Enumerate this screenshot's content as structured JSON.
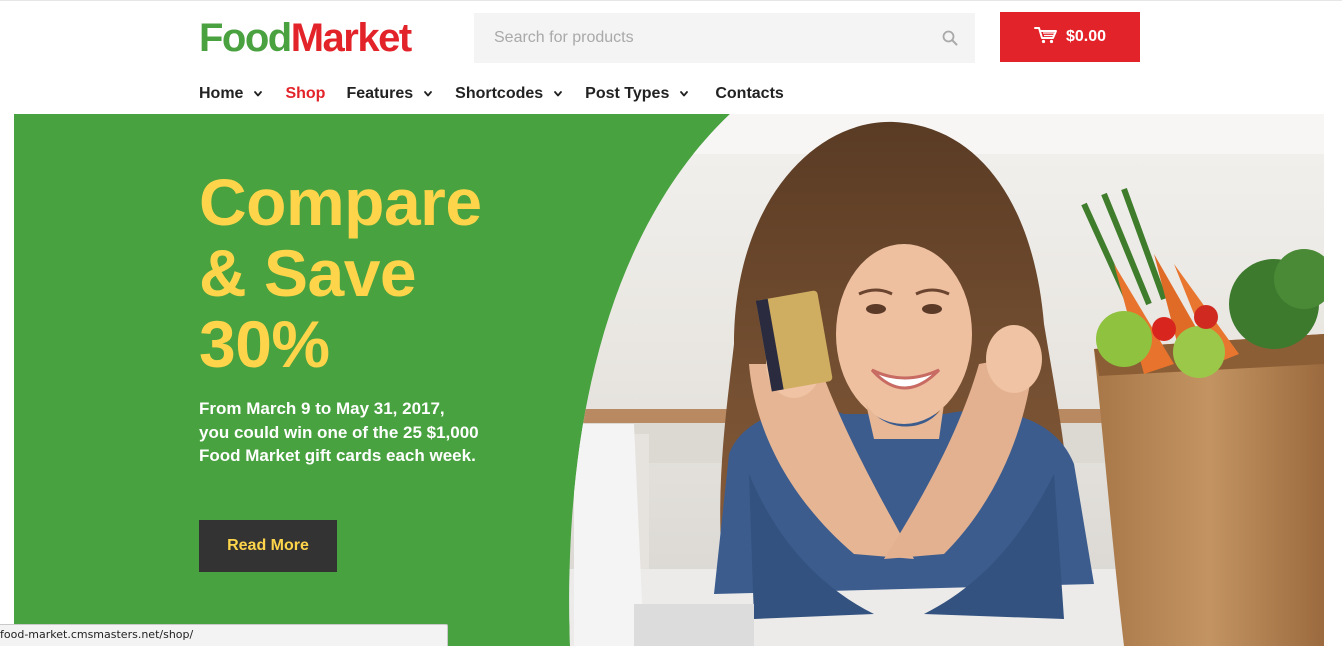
{
  "brand": {
    "logo_part1": "Food",
    "logo_part2": "Market",
    "primary_color": "#4aa13f",
    "accent_color": "#e3232a",
    "highlight_color": "#fed54a"
  },
  "search": {
    "placeholder": "Search for products",
    "icon": "search-icon"
  },
  "cart": {
    "icon": "cart-icon",
    "total": "$0.00"
  },
  "nav": {
    "items": [
      {
        "label": "Home",
        "has_dropdown": true,
        "active": false
      },
      {
        "label": "Shop",
        "has_dropdown": false,
        "active": true
      },
      {
        "label": "Features",
        "has_dropdown": true,
        "active": false
      },
      {
        "label": "Shortcodes",
        "has_dropdown": true,
        "active": false
      },
      {
        "label": "Post Types",
        "has_dropdown": true,
        "active": false
      },
      {
        "label": "Contacts",
        "has_dropdown": false,
        "active": false
      }
    ]
  },
  "hero": {
    "title_line1": "Compare",
    "title_line2": "& Save",
    "title_line3": "30%",
    "text_line1": "From March 9 to May 31, 2017,",
    "text_line2": "you could win one of the 25 $1,000",
    "text_line3": "Food Market gift cards each week.",
    "button_label": "Read More"
  },
  "statusbar": {
    "url": "food-market.cmsmasters.net/shop/"
  }
}
